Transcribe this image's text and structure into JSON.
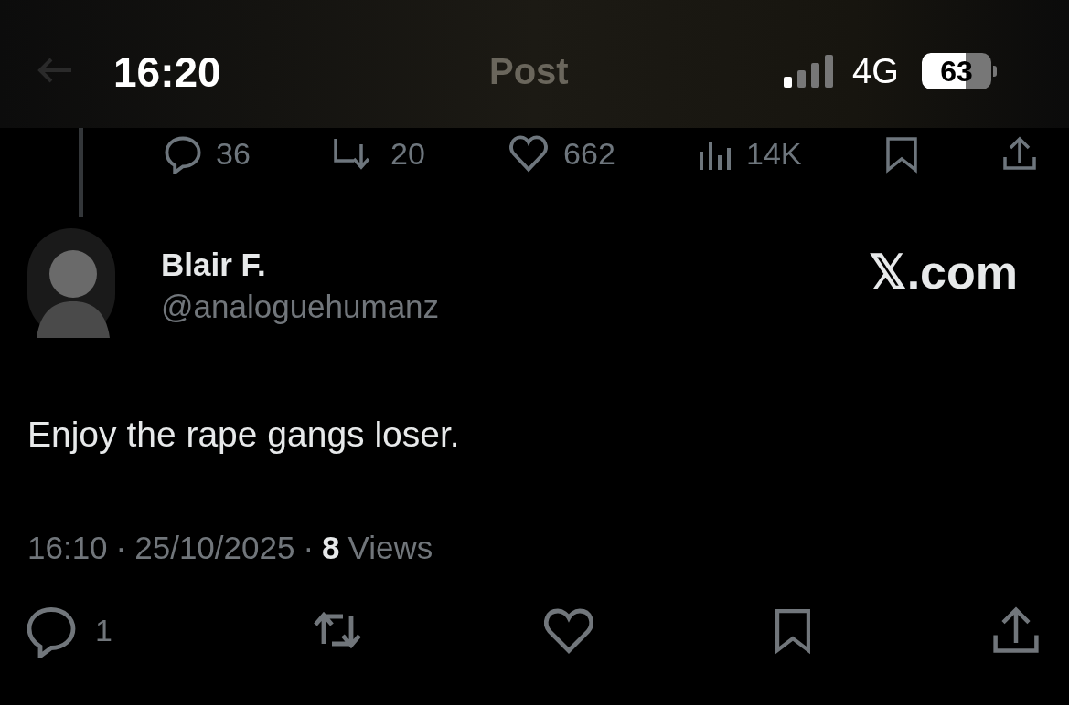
{
  "status_bar": {
    "time": "16:20",
    "network": "4G",
    "battery": "63"
  },
  "header": {
    "title": "Post"
  },
  "previous_post_actions": [
    {
      "kind": "reply",
      "count": "36"
    },
    {
      "kind": "repost",
      "count": "20"
    },
    {
      "kind": "like",
      "count": "662"
    },
    {
      "kind": "views",
      "count": "14K"
    },
    {
      "kind": "bookmark"
    },
    {
      "kind": "share"
    }
  ],
  "post": {
    "name": "Blair F.",
    "handle": "@analoguehumanz",
    "source": "𝕏.com",
    "text": "Enjoy the rape gangs loser.",
    "time": "16:10",
    "separator": "·",
    "date": "25/10/2025",
    "views_count": "8",
    "views_label": "Views"
  },
  "actions": [
    {
      "kind": "reply",
      "count": "1"
    },
    {
      "kind": "repost"
    },
    {
      "kind": "like"
    },
    {
      "kind": "bookmark"
    },
    {
      "kind": "share"
    }
  ]
}
